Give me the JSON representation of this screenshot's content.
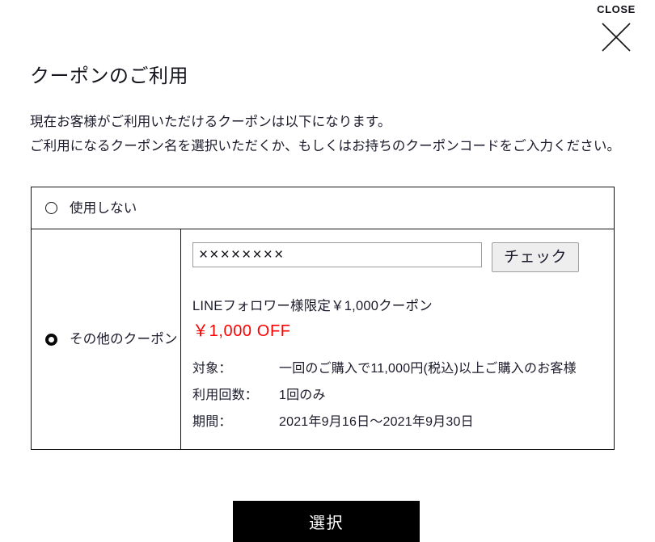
{
  "close": {
    "label": "CLOSE",
    "icon": "close-x-icon"
  },
  "header": {
    "title": "クーポンのご利用",
    "description_line1": "現在お客様がご利用いただけるクーポンは以下になります。",
    "description_line2": "ご利用になるクーポン名を選択いただくか、もしくはお持ちのクーポンコードをご入力ください。"
  },
  "options": [
    {
      "id": "no-use",
      "label": "使用しない",
      "selected": false
    },
    {
      "id": "other-coupon",
      "label": "その他のクーポン",
      "selected": true
    }
  ],
  "coupon_form": {
    "code_value": "××××××××",
    "code_placeholder": "",
    "check_label": "チェック"
  },
  "coupon_detail": {
    "name": "LINEフォロワー様限定￥1,000クーポン",
    "discount": "￥1,000 OFF",
    "discount_color": "#FE0000",
    "terms": [
      {
        "label": "対象：",
        "value": "一回のご購入で11,000円(税込)以上ご購入のお客様"
      },
      {
        "label": "利用回数：",
        "value": "1回のみ"
      },
      {
        "label": "期間：",
        "value": "2021年9月16日〜2021年9月30日"
      }
    ]
  },
  "footer": {
    "select_label": "選択"
  }
}
